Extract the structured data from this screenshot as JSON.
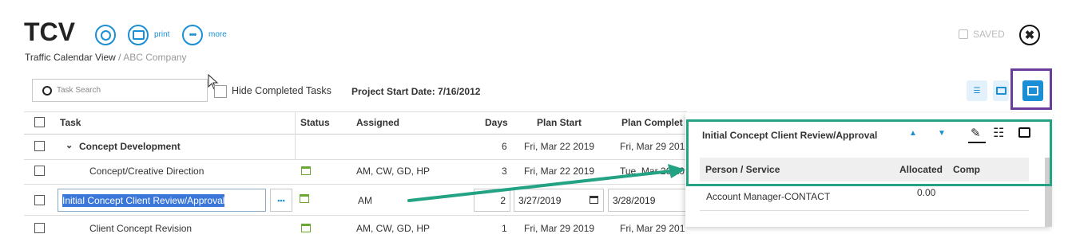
{
  "header": {
    "title": "TCV",
    "print_label": "print",
    "more_label": "more",
    "breadcrumb_current": "Traffic Calendar View",
    "breadcrumb_sep": " / ",
    "breadcrumb_company": "ABC Company",
    "saved_label": "SAVED"
  },
  "toolbar": {
    "search_placeholder": "Task Search",
    "hide_completed_label": "Hide Completed Tasks",
    "project_start": "Project Start Date: 7/16/2012"
  },
  "table": {
    "columns": {
      "task": "Task",
      "status": "Status",
      "assigned": "Assigned",
      "days": "Days",
      "plan_start": "Plan Start",
      "plan_complete": "Plan Complet"
    },
    "rows": [
      {
        "task": "Concept Development",
        "assigned": "",
        "days": "6",
        "plan_start": "Fri, Mar 22 2019",
        "plan_complete": "Fri, Mar 29 201"
      },
      {
        "task": "Concept/Creative Direction",
        "assigned": "AM, CW, GD, HP",
        "days": "3",
        "plan_start": "Fri, Mar 22 2019",
        "plan_complete": "Tue, Mar 26 20"
      },
      {
        "task": "Initial Concept Client Review/Approval",
        "assigned": "AM",
        "days": "2",
        "plan_start": "3/27/2019",
        "plan_complete": "3/28/2019"
      },
      {
        "task": "Client Concept Revision",
        "assigned": "AM, CW, GD, HP",
        "days": "1",
        "plan_start": "Fri, Mar 29 2019",
        "plan_complete": "Fri, Mar 29 201"
      }
    ]
  },
  "panel": {
    "title": "Initial Concept Client Review/Approval",
    "col_person": "Person / Service",
    "col_allocated": "Allocated",
    "col_comp": "Comp",
    "rows": [
      {
        "person": "Account Manager-CONTACT",
        "allocated": "0.00"
      }
    ]
  },
  "colors": {
    "accent": "#1b8fd6",
    "highlight_green": "#23a383",
    "highlight_purple": "#6a3d9a",
    "status_green": "#6aa832"
  }
}
